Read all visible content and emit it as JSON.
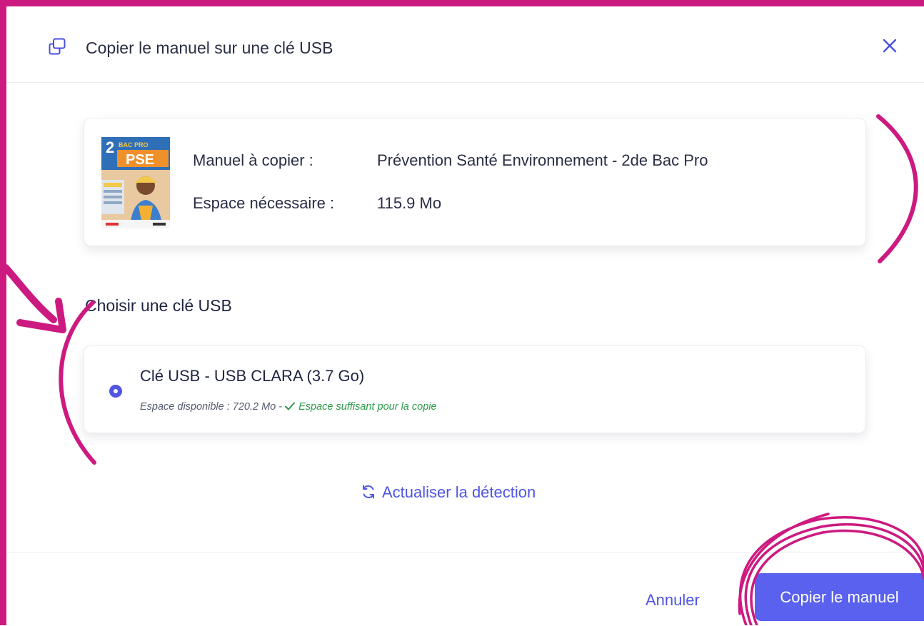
{
  "dialog": {
    "title": "Copier le manuel sur une clé USB",
    "icons": {
      "header": "copy-window-icon",
      "close": "close-icon"
    }
  },
  "book": {
    "cover": {
      "level": "2",
      "tag": "BAC PRO",
      "subject": "PSE"
    },
    "manual_label": "Manuel à copier :",
    "manual_value": "Prévention Santé Environnement - 2de Bac Pro",
    "space_label": "Espace nécessaire :",
    "space_value": "115.9 Mo"
  },
  "usb_section": {
    "title": "Choisir une clé USB",
    "devices": [
      {
        "name": "Clé USB - USB CLARA (3.7 Go)",
        "selected": true,
        "available": "Espace disponible : 720.2 Mo -",
        "status": "Espace suffisant pour la copie",
        "status_icon": "check-icon"
      }
    ]
  },
  "refresh": {
    "label": "Actualiser la détection",
    "icon": "refresh-icon"
  },
  "footer": {
    "cancel_label": "Annuler",
    "copy_label": "Copier le manuel"
  },
  "colors": {
    "accent": "#5055e4",
    "primary_button": "#5961ee",
    "success": "#2a9a48",
    "annotation": "#cc1a80"
  }
}
